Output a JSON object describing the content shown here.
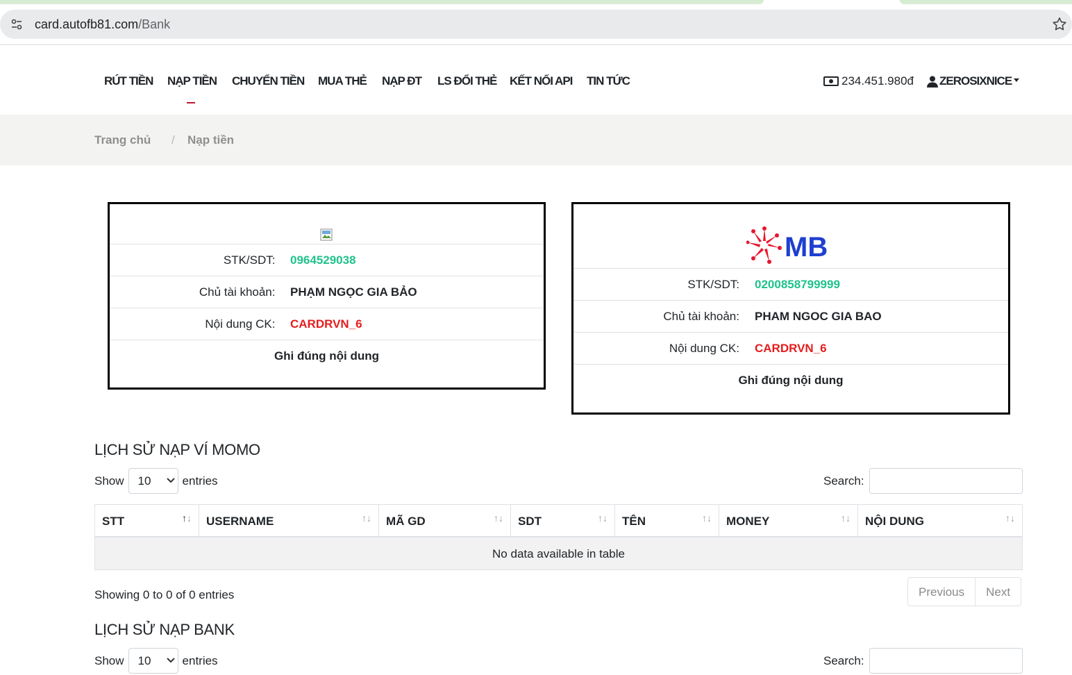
{
  "browser": {
    "url_host": "card.autofb81.com",
    "url_path": "/Bank"
  },
  "nav": {
    "items": [
      {
        "label": "RÚT TIỀN"
      },
      {
        "label": "NẠP TIỀN",
        "active": true
      },
      {
        "label": "CHUYỂN TIỀN"
      },
      {
        "label": "MUA THẺ"
      },
      {
        "label": "NẠP ĐT"
      },
      {
        "label": "LS ĐỔI THẺ"
      },
      {
        "label": "KẾT NỐI API"
      },
      {
        "label": "TIN TỨC"
      }
    ],
    "balance": "234.451.980đ",
    "username": "ZEROSIXNICE"
  },
  "breadcrumb": {
    "home": "Trang chủ",
    "separator": "/",
    "current": "Nạp tiền"
  },
  "cards": [
    {
      "logo": "broken-image-icon",
      "account_label": "STK/SDT:",
      "account_value": "0964529038",
      "owner_label": "Chủ tài khoản:",
      "owner_value": "PHẠM NGỌC GIA BẢO",
      "content_label": "Nội dung CK:",
      "content_value": "CARDRVN_6",
      "note": "Ghi đúng nội dung"
    },
    {
      "logo": "mb-bank-logo",
      "logo_text": "MB",
      "account_label": "STK/SDT:",
      "account_value": "0200858799999",
      "owner_label": "Chủ tài khoản:",
      "owner_value": "PHAM NGOC GIA BAO",
      "content_label": "Nội dung CK:",
      "content_value": "CARDRVN_6",
      "note": "Ghi đúng nội dung"
    }
  ],
  "momo_section": {
    "title": "LỊCH SỬ NẠP VÍ MOMO",
    "show_label": "Show",
    "entries_value": "10",
    "entries_label": "entries",
    "search_label": "Search:",
    "columns": [
      "STT",
      "USERNAME",
      "MÃ GD",
      "SDT",
      "TÊN",
      "MONEY",
      "NỘI DUNG"
    ],
    "empty_text": "No data available in table",
    "info": "Showing 0 to 0 of 0 entries",
    "prev": "Previous",
    "next": "Next"
  },
  "bank_section": {
    "title": "LỊCH SỬ NẠP BANK",
    "show_label": "Show",
    "entries_value": "10",
    "entries_label": "entries",
    "search_label": "Search:"
  },
  "colors": {
    "accent_green": "#1fc28c",
    "accent_red": "#e41d1d",
    "mb_blue": "#1e3fd0",
    "mb_red": "#e6172d"
  }
}
